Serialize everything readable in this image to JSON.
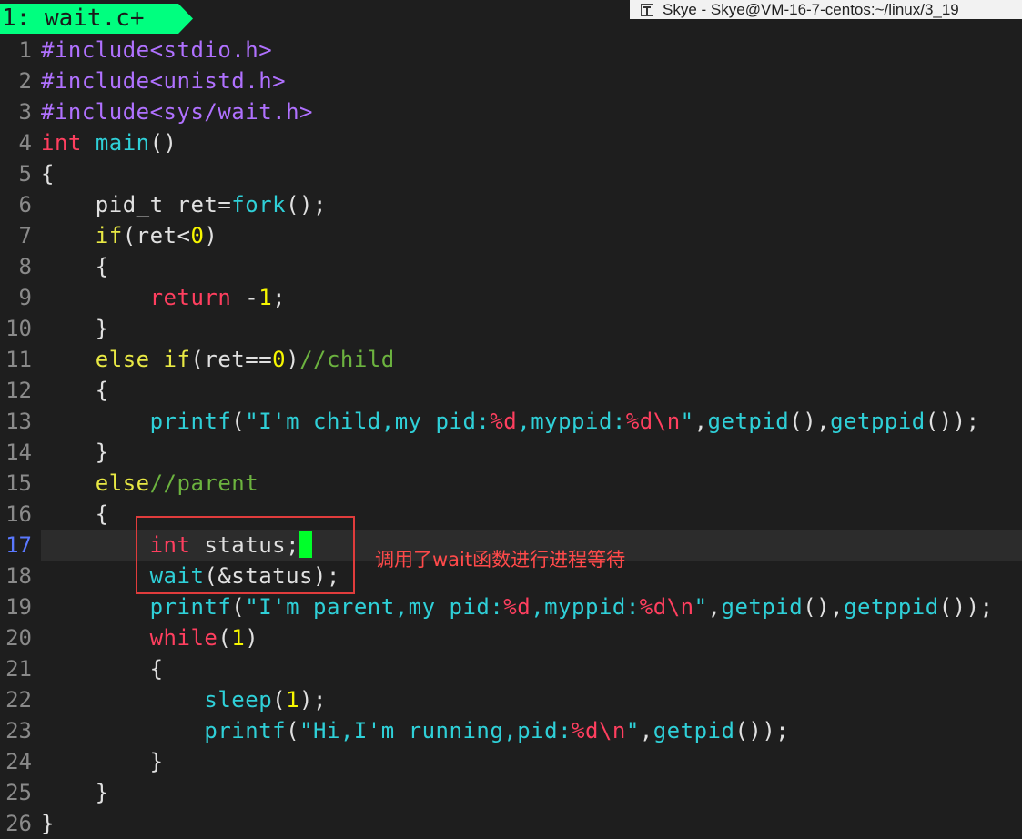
{
  "tab": {
    "label": "1: wait.c+"
  },
  "window": {
    "title": "Skye - Skye@VM-16-7-centos:~/linux/3_19"
  },
  "annotation": {
    "text": "调用了wait函数进行进程等待"
  },
  "current_line": 17,
  "lines": [
    {
      "num": "1",
      "tokens": [
        [
          "pp",
          "#include<stdio.h>"
        ]
      ]
    },
    {
      "num": "2",
      "tokens": [
        [
          "pp",
          "#include<unistd.h>"
        ]
      ]
    },
    {
      "num": "3",
      "tokens": [
        [
          "pp",
          "#include<sys/wait.h>"
        ]
      ]
    },
    {
      "num": "4",
      "tokens": [
        [
          "ty",
          "int"
        ],
        [
          "pl",
          " "
        ],
        [
          "fn",
          "main"
        ],
        [
          "pl",
          "()"
        ]
      ]
    },
    {
      "num": "5",
      "tokens": [
        [
          "pl",
          "{"
        ]
      ]
    },
    {
      "num": "6",
      "tokens": [
        [
          "pl",
          "    pid_t ret="
        ],
        [
          "fn",
          "fork"
        ],
        [
          "pl",
          "();"
        ]
      ]
    },
    {
      "num": "7",
      "tokens": [
        [
          "pl",
          "    "
        ],
        [
          "kw",
          "if"
        ],
        [
          "pl",
          "(ret<"
        ],
        [
          "nm",
          "0"
        ],
        [
          "pl",
          ")"
        ]
      ]
    },
    {
      "num": "8",
      "tokens": [
        [
          "pl",
          "    {"
        ]
      ]
    },
    {
      "num": "9",
      "tokens": [
        [
          "pl",
          "        "
        ],
        [
          "rk",
          "return"
        ],
        [
          "pl",
          " -"
        ],
        [
          "nm",
          "1"
        ],
        [
          "pl",
          ";"
        ]
      ]
    },
    {
      "num": "10",
      "tokens": [
        [
          "pl",
          "    }"
        ]
      ]
    },
    {
      "num": "11",
      "tokens": [
        [
          "pl",
          "    "
        ],
        [
          "kw",
          "else"
        ],
        [
          "pl",
          " "
        ],
        [
          "kw",
          "if"
        ],
        [
          "pl",
          "(ret=="
        ],
        [
          "nm",
          "0"
        ],
        [
          "pl",
          ")"
        ],
        [
          "cm",
          "//child"
        ]
      ]
    },
    {
      "num": "12",
      "tokens": [
        [
          "pl",
          "    {"
        ]
      ]
    },
    {
      "num": "13",
      "tokens": [
        [
          "pl",
          "        "
        ],
        [
          "fn",
          "printf"
        ],
        [
          "pl",
          "("
        ],
        [
          "st",
          "\"I'm child,my pid:"
        ],
        [
          "fmt",
          "%d"
        ],
        [
          "st",
          ",myppid:"
        ],
        [
          "fmt",
          "%d\\n"
        ],
        [
          "st",
          "\""
        ],
        [
          "pl",
          ","
        ],
        [
          "fn",
          "getpid"
        ],
        [
          "pl",
          "(),"
        ],
        [
          "fn",
          "getppid"
        ],
        [
          "pl",
          "());"
        ]
      ]
    },
    {
      "num": "14",
      "tokens": [
        [
          "pl",
          "    }"
        ]
      ]
    },
    {
      "num": "15",
      "tokens": [
        [
          "pl",
          "    "
        ],
        [
          "kw",
          "else"
        ],
        [
          "cm",
          "//parent"
        ]
      ]
    },
    {
      "num": "16",
      "tokens": [
        [
          "pl",
          "    {"
        ]
      ]
    },
    {
      "num": "17",
      "tokens": [
        [
          "pl",
          "        "
        ],
        [
          "ty",
          "int"
        ],
        [
          "pl",
          " status;"
        ]
      ],
      "cursor": true
    },
    {
      "num": "18",
      "tokens": [
        [
          "pl",
          "        "
        ],
        [
          "fn",
          "wait"
        ],
        [
          "pl",
          "(&status);"
        ]
      ]
    },
    {
      "num": "19",
      "tokens": [
        [
          "pl",
          "        "
        ],
        [
          "fn",
          "printf"
        ],
        [
          "pl",
          "("
        ],
        [
          "st",
          "\"I'm parent,my pid:"
        ],
        [
          "fmt",
          "%d"
        ],
        [
          "st",
          ",myppid:"
        ],
        [
          "fmt",
          "%d\\n"
        ],
        [
          "st",
          "\""
        ],
        [
          "pl",
          ","
        ],
        [
          "fn",
          "getpid"
        ],
        [
          "pl",
          "(),"
        ],
        [
          "fn",
          "getppid"
        ],
        [
          "pl",
          "());"
        ]
      ]
    },
    {
      "num": "20",
      "tokens": [
        [
          "pl",
          "        "
        ],
        [
          "rk",
          "while"
        ],
        [
          "pl",
          "("
        ],
        [
          "nm",
          "1"
        ],
        [
          "pl",
          ")"
        ]
      ]
    },
    {
      "num": "21",
      "tokens": [
        [
          "pl",
          "        {"
        ]
      ]
    },
    {
      "num": "22",
      "tokens": [
        [
          "pl",
          "            "
        ],
        [
          "fn",
          "sleep"
        ],
        [
          "pl",
          "("
        ],
        [
          "nm",
          "1"
        ],
        [
          "pl",
          ");"
        ]
      ]
    },
    {
      "num": "23",
      "tokens": [
        [
          "pl",
          "            "
        ],
        [
          "fn",
          "printf"
        ],
        [
          "pl",
          "("
        ],
        [
          "st",
          "\"Hi,I'm running,pid:"
        ],
        [
          "fmt",
          "%d\\n"
        ],
        [
          "st",
          "\""
        ],
        [
          "pl",
          ","
        ],
        [
          "fn",
          "getpid"
        ],
        [
          "pl",
          "());"
        ]
      ]
    },
    {
      "num": "24",
      "tokens": [
        [
          "pl",
          "        }"
        ]
      ]
    },
    {
      "num": "25",
      "tokens": [
        [
          "pl",
          "    }"
        ]
      ]
    },
    {
      "num": "26",
      "tokens": [
        [
          "pl",
          "}"
        ]
      ]
    }
  ],
  "colors": {
    "tab_bg": "#00ff7f",
    "cursor": "#00ff2a",
    "annotation": "#ff4a4a",
    "highlight_border": "#e03c3c",
    "current_line_number": "#5a78ff"
  }
}
